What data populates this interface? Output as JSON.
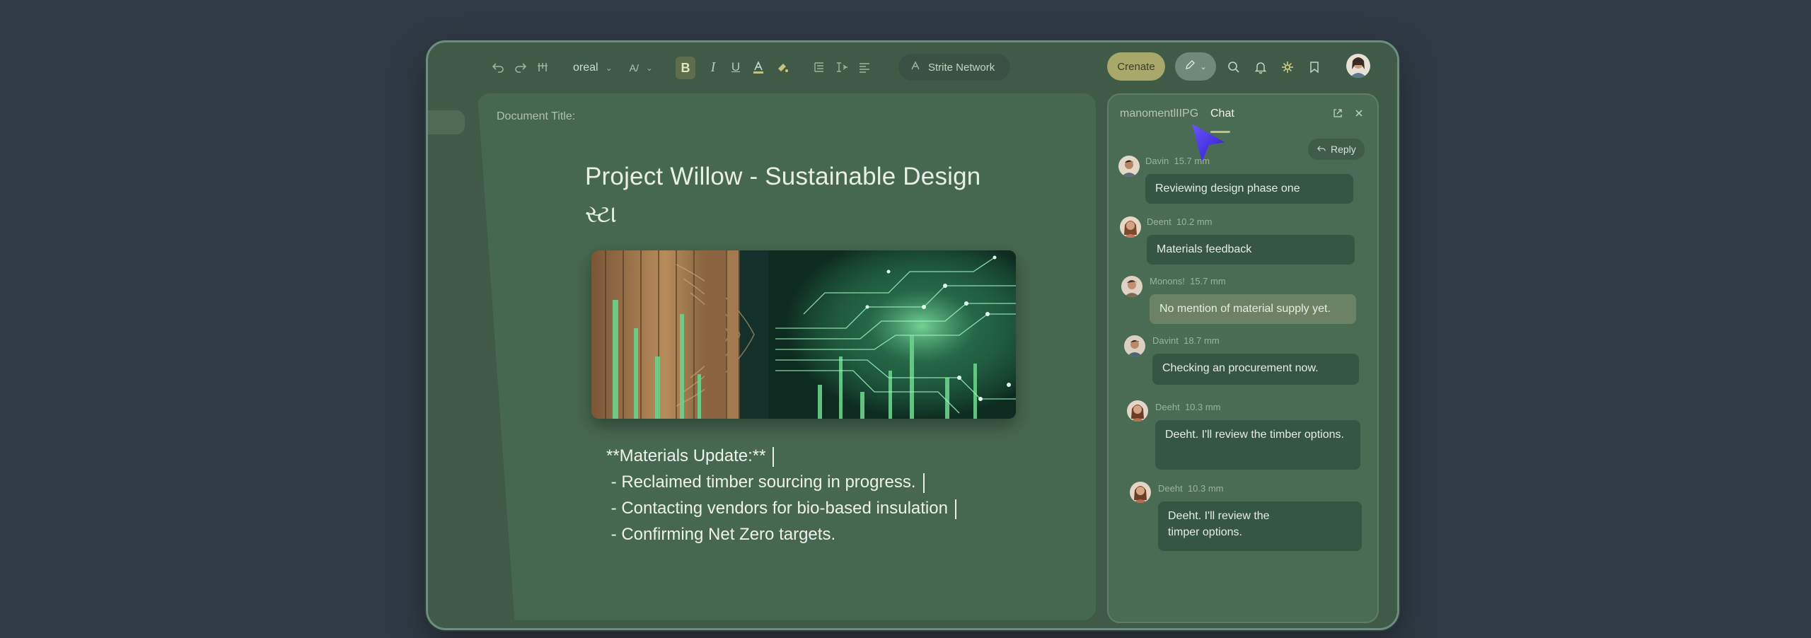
{
  "toolbar": {
    "font_name": "oreal",
    "bold_label": "B",
    "italic_label": "I",
    "underline_label": "U",
    "network_label": "Strite Network",
    "create_label": "Crenate"
  },
  "document": {
    "title_label": "Document Title:",
    "heading": "Project Willow - Sustainable Design",
    "subheading": "સ્ટા",
    "notes": [
      "**Materials Update:**",
      " - Reclaimed timber sourcing in progress.",
      " - Contacting vendors for bio-based insulation",
      " - Confirming Net Zero targets."
    ]
  },
  "chat": {
    "tab_inactive": "manomentlIIPG",
    "tab_active": "Chat",
    "reply_label": "Reply",
    "messages": [
      {
        "author": "Davin",
        "meta": "15.7 mm",
        "text": "Reviewing design phase one"
      },
      {
        "author": "Deent",
        "meta": "10.2 mm",
        "text": "Materials feedback"
      },
      {
        "author": "Monons!",
        "meta": "15.7 mm",
        "text": "No mention of material supply yet."
      },
      {
        "author": "Davint",
        "meta": "18.7 mm",
        "text": "Checking an procurement now."
      },
      {
        "author": "Deeht",
        "meta": "10.3 mm",
        "text": "Deeht. I'll review the timber options."
      },
      {
        "author": "Deeht",
        "meta": "10.3 mm",
        "text": "Deeht. I'll review the timper options."
      }
    ]
  },
  "colors": {
    "background": "#2f3a44",
    "window": "#3f5b47",
    "accent": "#a8a86a",
    "cursor": "#4a2cff"
  }
}
